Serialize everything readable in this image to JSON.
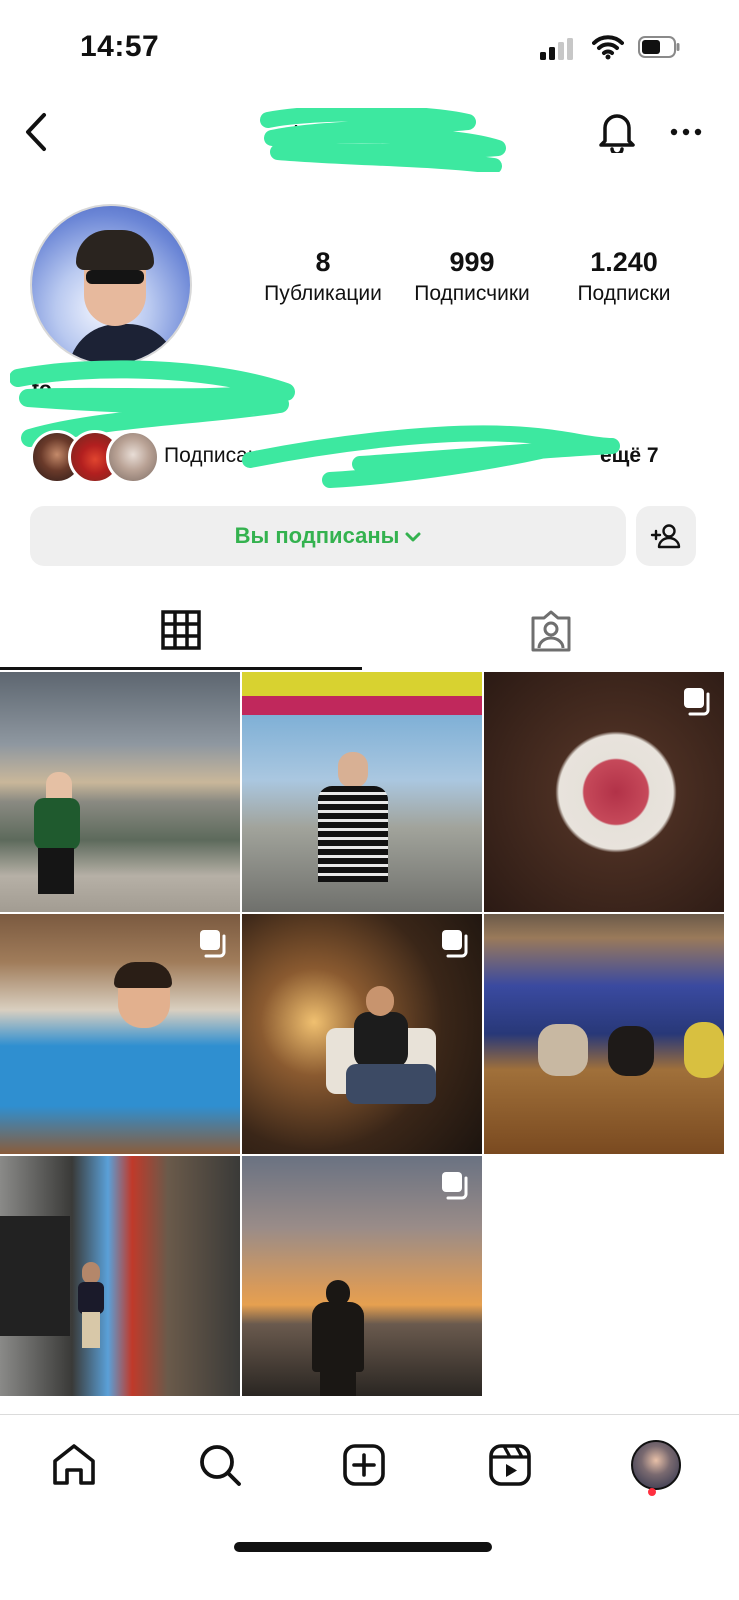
{
  "status_bar": {
    "time": "14:57"
  },
  "header": {
    "username": "to"
  },
  "profile": {
    "display_name": "to",
    "stats": [
      {
        "value": "8",
        "label": "Публикации"
      },
      {
        "value": "999",
        "label": "Подписчики"
      },
      {
        "value": "1.240",
        "label": "Подписки"
      }
    ],
    "followed_by_text": "Подписан",
    "followed_by_more": "ещё 7"
  },
  "actions": {
    "following_label": "Вы подписаны"
  },
  "tabs": {
    "active": "grid"
  },
  "icons": {
    "back": "chevron-left-icon",
    "bell": "bell-icon",
    "more": "more-horizontal-icon",
    "add_user": "add-user-icon",
    "grid": "grid-icon",
    "tagged": "tagged-person-icon",
    "multi": "carousel-icon",
    "home": "home-icon",
    "search": "search-icon",
    "create": "plus-square-icon",
    "reels": "reels-icon"
  },
  "colors": {
    "accent_green": "#34b24f",
    "redaction": "#3de8a0",
    "notification": "#ff3040"
  }
}
